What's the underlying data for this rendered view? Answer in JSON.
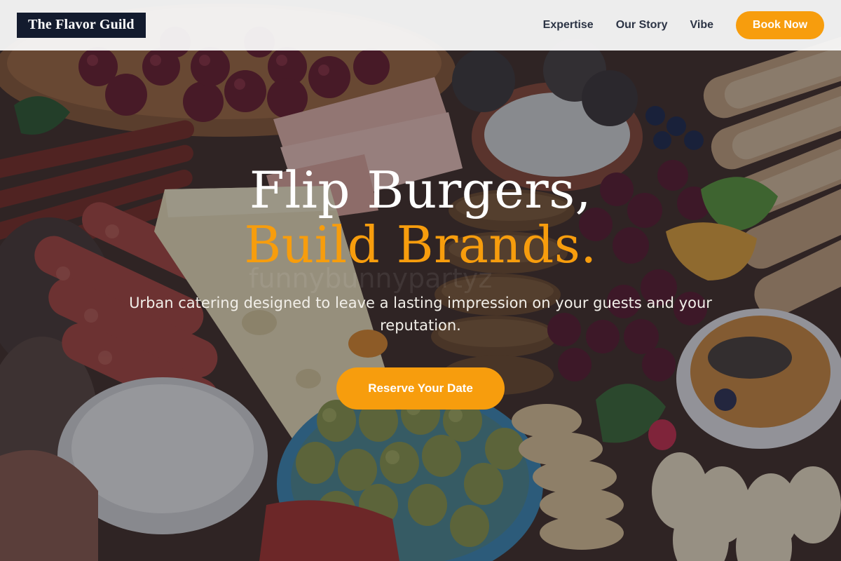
{
  "brand": {
    "logo_text": "The Flavor Guild"
  },
  "nav": {
    "links": [
      "Expertise",
      "Our Story",
      "Vibe"
    ],
    "cta_label": "Book Now"
  },
  "hero": {
    "headline_line1": "Flip Burgers,",
    "headline_line2": "Build Brands.",
    "subtitle": "Urban catering designed to leave a lasting impression on your guests and your reputation.",
    "cta_label": "Reserve Your Date",
    "watermark_text": "funnybunnypartyz"
  },
  "colors": {
    "accent": "#f79d0d",
    "logo_bg": "#131b2e",
    "header_bg": "#fafafa",
    "nav_text": "#2c3445"
  },
  "hero_image": {
    "subject": "charcuterie-board-spread"
  }
}
